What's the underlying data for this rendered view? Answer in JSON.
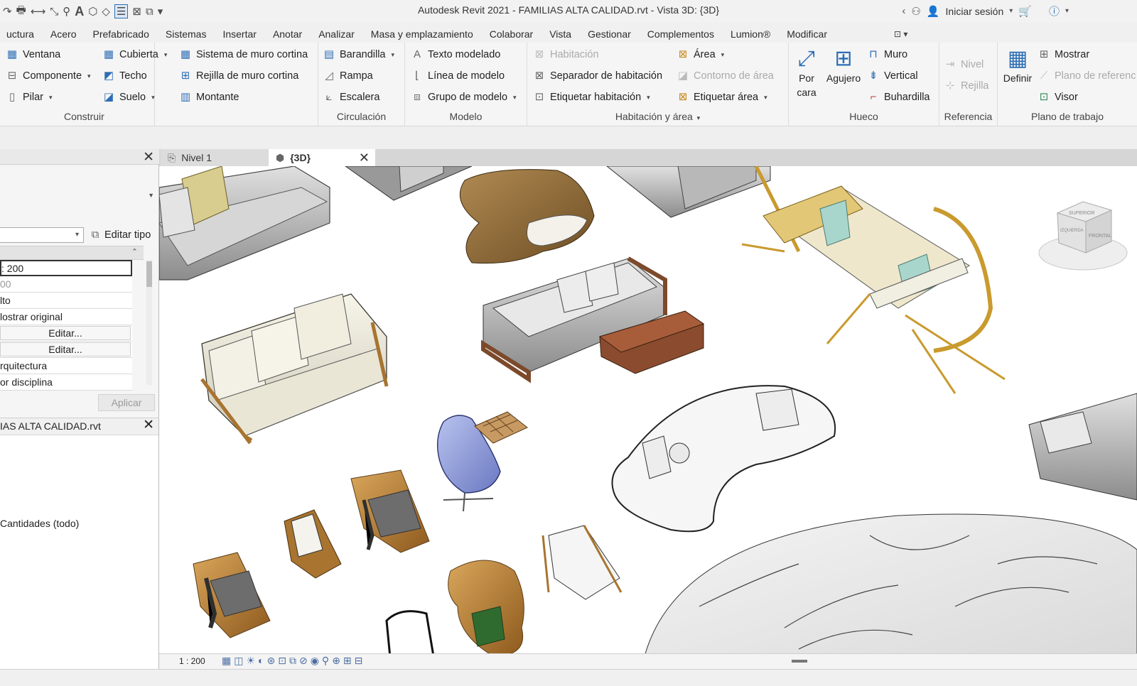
{
  "window": {
    "title": "Autodesk Revit 2021 - FAMILIAS ALTA CALIDAD.rvt - Vista 3D: {3D}",
    "sign_in": "Iniciar sesión"
  },
  "ribbon_tabs": [
    "uctura",
    "Acero",
    "Prefabricado",
    "Sistemas",
    "Insertar",
    "Anotar",
    "Analizar",
    "Masa y emplazamiento",
    "Colaborar",
    "Vista",
    "Gestionar",
    "Complementos",
    "Lumion®",
    "Modificar"
  ],
  "panels": {
    "construir": {
      "title": "Construir",
      "ventana": "Ventana",
      "componente": "Componente",
      "pilar": "Pilar",
      "cubierta": "Cubierta",
      "techo": "Techo",
      "suelo": "Suelo",
      "sistema_muro_cortina": "Sistema de muro cortina",
      "rejilla_muro_cortina": "Rejilla de muro cortina",
      "montante": "Montante"
    },
    "circulacion": {
      "title": "Circulación",
      "barandilla": "Barandilla",
      "rampa": "Rampa",
      "escalera": "Escalera"
    },
    "modelo": {
      "title": "Modelo",
      "texto_modelado": "Texto modelado",
      "linea_modelo": "Línea de modelo",
      "grupo_modelo": "Grupo de modelo"
    },
    "habitacion": {
      "title": "Habitación y área",
      "habitacion": "Habitación",
      "separador": "Separador  de habitación",
      "etiquetar_habitacion": "Etiquetar  habitación",
      "area": "Área",
      "contorno_area": "Contorno  de área",
      "etiquetar_area": "Etiquetar  área"
    },
    "hueco": {
      "title": "Hueco",
      "por_cara_1": "Por",
      "por_cara_2": "cara",
      "agujero": "Agujero",
      "muro": "Muro",
      "vertical": "Vertical",
      "buhardilla": "Buhardilla"
    },
    "referencia": {
      "title": "Referencia",
      "nivel": "Nivel",
      "rejilla": "Rejilla"
    },
    "plano_trabajo": {
      "title": "Plano de trabajo",
      "definir": "Definir",
      "mostrar": "Mostrar",
      "plano_referencia": "Plano de referenc",
      "visor": "Visor"
    }
  },
  "properties": {
    "edit_type": "Editar tipo",
    "rows": [
      ": 200",
      "00",
      "lto",
      "lostrar original",
      "Editar...",
      "Editar...",
      "rquitectura",
      "or disciplina"
    ],
    "apply": "Aplicar"
  },
  "browser": {
    "title": "IAS ALTA CALIDAD.rvt",
    "item": "Cantidades (todo)"
  },
  "view_tabs": {
    "level1": "Nivel 1",
    "view3d": "{3D}"
  },
  "viewcube": {
    "top": "SUPERIOR",
    "front": "FRONTAL",
    "left": "IZQUIERDA"
  },
  "view_bar": {
    "scale": "1 : 200"
  },
  "colors": {
    "accent": "#2d6db5",
    "cushion_white": "#ecebe4",
    "wood": "#a8742f",
    "grey_fabric": "#8a8a8a"
  }
}
